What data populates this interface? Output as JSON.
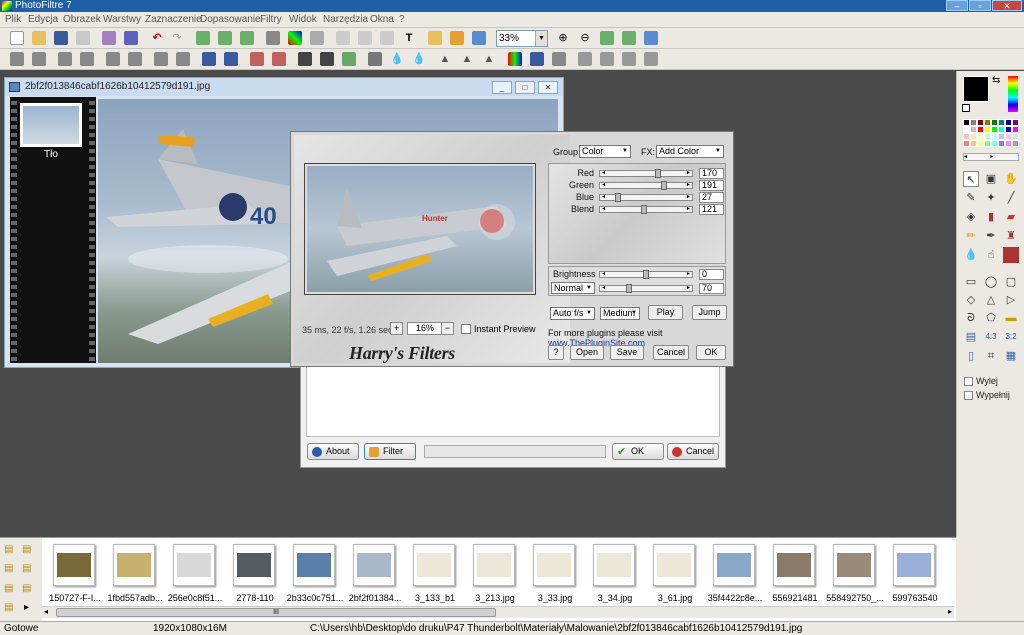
{
  "app": {
    "title": "PhotoFiltre 7"
  },
  "menu": [
    "Plik",
    "Edycja",
    "Obrazek",
    "Warstwy",
    "Zaznaczenie",
    "Dopasowanie",
    "Filtry",
    "Widok",
    "Narzędzia",
    "Okna",
    "?"
  ],
  "toolbar": {
    "zoom": "33%"
  },
  "image_window": {
    "title": "2bf2f013846cabf1626b10412579d191.jpg",
    "layer_label": "Tło"
  },
  "harrys_filters": {
    "group_label": "Group:",
    "group_value": "Color",
    "fx_label": "FX:",
    "fx_value": "Add Color",
    "sliders": [
      {
        "label": "Red",
        "value": "170",
        "level": 0.67
      },
      {
        "label": "Green",
        "value": "191",
        "level": 0.75
      },
      {
        "label": "Blue",
        "value": "27",
        "level": 0.11
      },
      {
        "label": "Blend",
        "value": "121",
        "level": 0.47
      }
    ],
    "brightness_label": "Brightness",
    "brightness_value": "0",
    "brightness_level": 0.5,
    "mode_value": "Normal",
    "mode_slider_value": "70",
    "mode_level": 0.27,
    "auto_fps": "Auto f/s",
    "quality": "Medium",
    "play_label": "Play",
    "jump_label": "Jump",
    "stats": "35 ms, 22 f/s, 1.26 sec",
    "zoom_plus": "+",
    "zoom_value": "16%",
    "zoom_minus": "−",
    "instant_preview": "Instant Preview",
    "plugins_text": "For more plugins please visit",
    "plugins_link": "www.ThePluginSite.com",
    "brand": "Harry's Filters",
    "help_label": "?",
    "open_label": "Open",
    "save_label": "Save",
    "cancel_label": "Cancel",
    "ok_label": "OK"
  },
  "plugin_dialog": {
    "about_label": "About",
    "filter_label": "Filter",
    "ok_label": "OK",
    "cancel_label": "Cancel"
  },
  "palette": {
    "foreground": "#000000",
    "background": "#ffffff",
    "swatches": [
      "#000000",
      "#808080",
      "#800000",
      "#808000",
      "#008000",
      "#008080",
      "#000080",
      "#800080",
      "#ffffff",
      "#c0c0c0",
      "#ff0000",
      "#ffff00",
      "#00ff00",
      "#00ffff",
      "#0000ff",
      "#ff00ff",
      "#ffc0c0",
      "#ffe0c0",
      "#ffffc0",
      "#c0ffc0",
      "#c0ffff",
      "#c0c0ff",
      "#ffc0ff",
      "#e0e0e0",
      "#ff8080",
      "#ffc080",
      "#ffff80",
      "#80ff80",
      "#80ffff",
      "#8080ff",
      "#ff80ff",
      "#a0a0a0"
    ],
    "option_wylej": "Wylej",
    "option_wypelnij": "Wypełnij"
  },
  "browser": {
    "items": [
      {
        "name": "150727-F-I...",
        "color": "#7a6a3a"
      },
      {
        "name": "1fbd557adb...",
        "color": "#c8b070"
      },
      {
        "name": "256e0c8f51...",
        "color": "#d8d8d8"
      },
      {
        "name": "2778-110",
        "color": "#555c60"
      },
      {
        "name": "2b33c0c751...",
        "color": "#5a7fa8"
      },
      {
        "name": "2bf2f01384...",
        "color": "#a8b8c8"
      },
      {
        "name": "3_133_b1",
        "color": "#ece8d8"
      },
      {
        "name": "3_213.jpg",
        "color": "#ece8d8"
      },
      {
        "name": "3_33.jpg",
        "color": "#ece8d8"
      },
      {
        "name": "3_34.jpg",
        "color": "#ece8d8"
      },
      {
        "name": "3_61.jpg",
        "color": "#ece8d8"
      },
      {
        "name": "35f4422c8e...",
        "color": "#8aa8c8"
      },
      {
        "name": "556921481",
        "color": "#8a7a6a"
      },
      {
        "name": "558492750_...",
        "color": "#9a8a7a"
      },
      {
        "name": "599763540",
        "color": "#9ab0d8"
      }
    ],
    "scroll_grip": "III"
  },
  "status": {
    "state": "Gotowe",
    "dimensions": "1920x1080x16M",
    "path": "C:\\Users\\hb\\Desktop\\do druku\\P47 Thunderbolt\\Materiały\\Malowanie\\2bf2f013846cabf1626b10412579d191.jpg"
  }
}
